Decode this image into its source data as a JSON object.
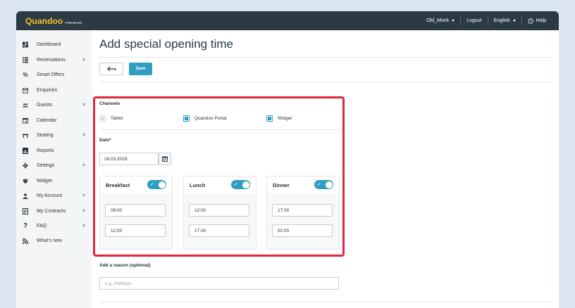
{
  "header": {
    "brand": "Quandoo",
    "tier": "PREMIUM",
    "user": "Old_Monk",
    "logout": "Logout",
    "language": "English",
    "help": "Help"
  },
  "sidebar": {
    "items": [
      {
        "label": "Dashboard",
        "icon": "dashboard-icon",
        "chevron": ""
      },
      {
        "label": "Reservations",
        "icon": "list-icon",
        "chevron": ">"
      },
      {
        "label": "Smart Offers",
        "icon": "percent-icon",
        "chevron": ""
      },
      {
        "label": "Enquiries",
        "icon": "envelope-icon",
        "chevron": ""
      },
      {
        "label": "Guests",
        "icon": "people-icon",
        "chevron": ">"
      },
      {
        "label": "Calendar",
        "icon": "calendar-icon",
        "chevron": ""
      },
      {
        "label": "Seating",
        "icon": "table-icon",
        "chevron": ">"
      },
      {
        "label": "Reports",
        "icon": "report-icon",
        "chevron": ""
      },
      {
        "label": "Settings",
        "icon": "gear-icon",
        "chevron": ">"
      },
      {
        "label": "Widget",
        "icon": "diamond-icon",
        "chevron": ""
      },
      {
        "label": "My Account",
        "icon": "person-icon",
        "chevron": ">"
      },
      {
        "label": "My Contracts",
        "icon": "document-icon",
        "chevron": ">"
      },
      {
        "label": "FAQ",
        "icon": "question-icon",
        "chevron": ">"
      },
      {
        "label": "What's new",
        "icon": "rss-icon",
        "chevron": ""
      }
    ]
  },
  "page": {
    "title": "Add special opening time",
    "save_label": "Save"
  },
  "channels": {
    "label": "Channels",
    "options": [
      {
        "label": "Tablet",
        "checked": false
      },
      {
        "label": "Quandoo Portal",
        "checked": true
      },
      {
        "label": "Widget",
        "checked": true
      }
    ]
  },
  "date": {
    "label": "Date*",
    "value": "28.03.2019"
  },
  "meals": [
    {
      "name": "Breakfast",
      "enabled": true,
      "from": "08:00",
      "to": "12:00"
    },
    {
      "name": "Lunch",
      "enabled": true,
      "from": "12:00",
      "to": "17:00"
    },
    {
      "name": "Dinner",
      "enabled": true,
      "from": "17:00",
      "to": "02:00"
    }
  ],
  "reason": {
    "label": "Add a reason (optional)",
    "placeholder": "e.g. Holidays"
  },
  "colors": {
    "accent": "#2e9fc2",
    "highlight": "#e0283c",
    "topbar": "#2b3a43",
    "brand": "#f6c32a"
  }
}
